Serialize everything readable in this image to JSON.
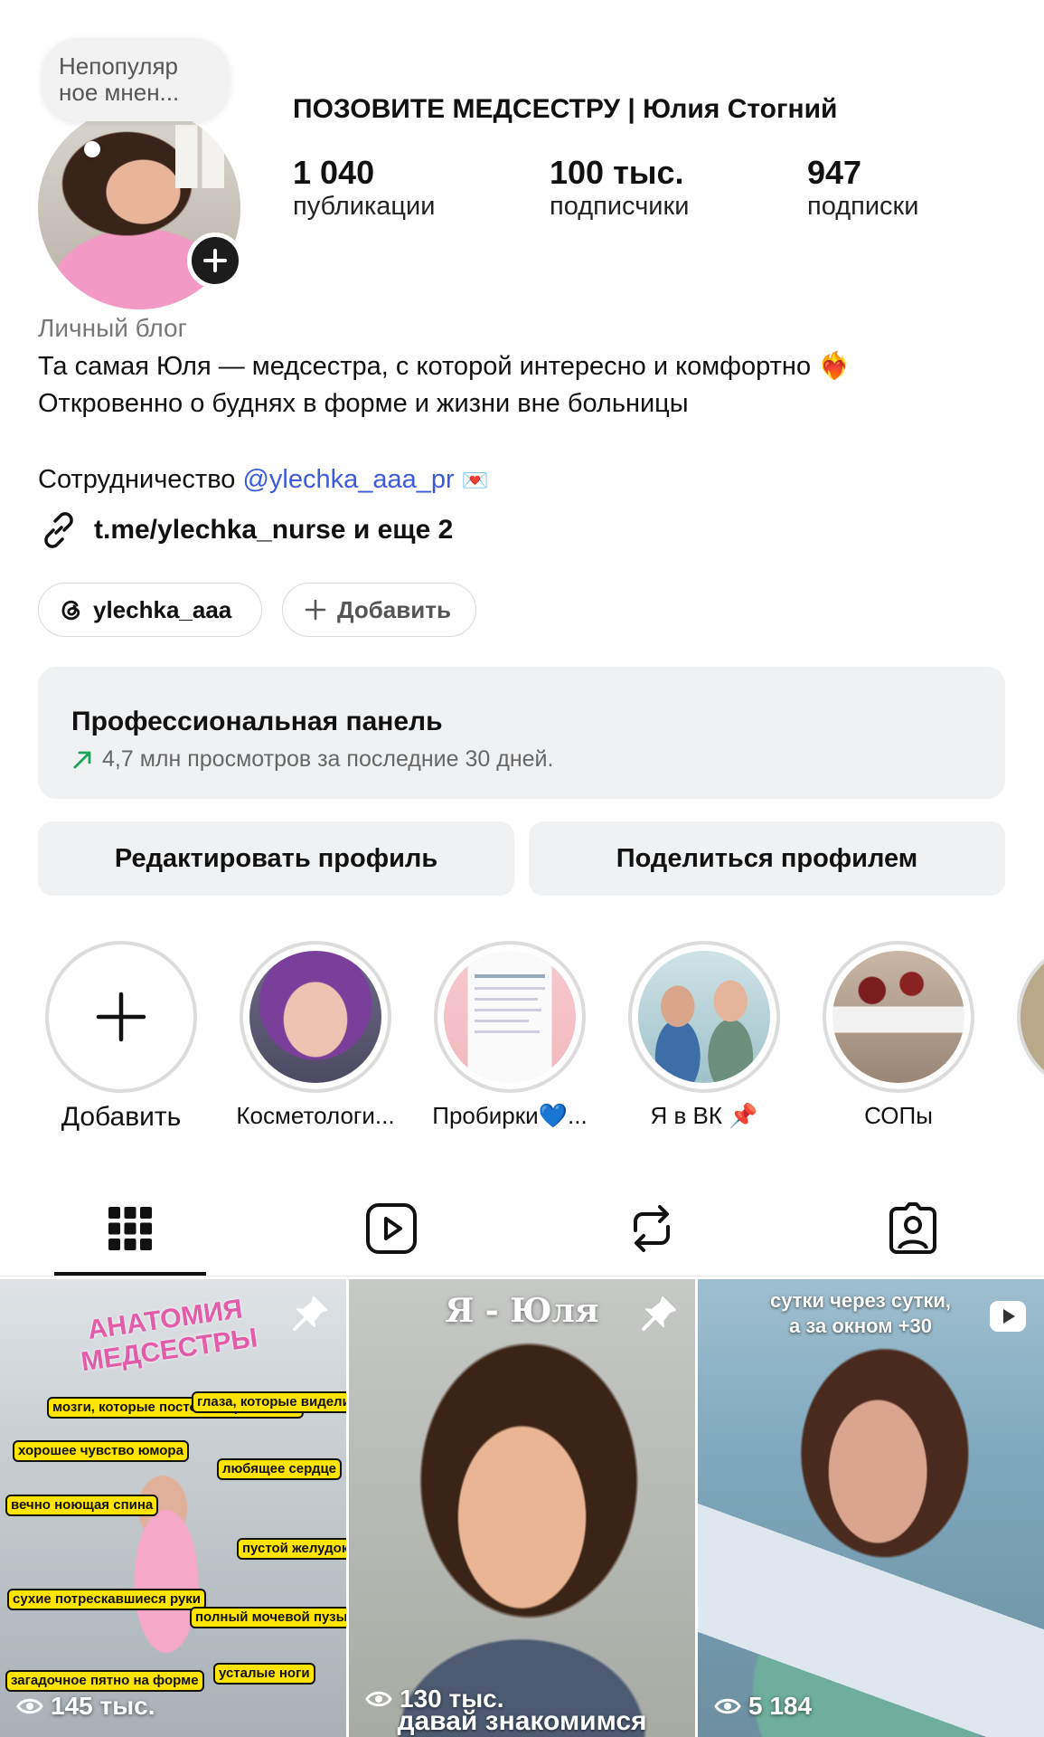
{
  "profile": {
    "note": "Непопуляр\nное мнен...",
    "name": "ПОЗОВИТЕ МЕДСЕСТРУ | Юлия Стогний",
    "stats": [
      {
        "value": "1 040",
        "label": "публикации"
      },
      {
        "value": "100 тыс.",
        "label": "подписчики"
      },
      {
        "value": "947",
        "label": "подписки"
      }
    ]
  },
  "bio": {
    "category": "Личный блог",
    "line1": "Та самая Юля — медсестра, с которой интересно и комфортно",
    "line2": "Откровенно о буднях в форме и жизни вне больницы",
    "collab_prefix": "Сотрудничество ",
    "collab_mention": "@ylechka_aaa_pr",
    "link": "t.me/ylechka_nurse и еще 2"
  },
  "chips": {
    "threads": "ylechka_aaa",
    "add": "Добавить"
  },
  "pro_panel": {
    "title": "Профессиональная панель",
    "subtitle": "4,7 млн просмотров за последние 30 дней."
  },
  "buttons": {
    "edit": "Редактировать профиль",
    "share": "Поделиться профилем"
  },
  "highlights": [
    {
      "label": "Добавить"
    },
    {
      "label": "Косметологи..."
    },
    {
      "label": "Пробирки💙..."
    },
    {
      "label": "Я в ВК 📌"
    },
    {
      "label": "СОПы"
    }
  ],
  "tabs": [
    {
      "icon": "grid-icon"
    },
    {
      "icon": "reels-icon"
    },
    {
      "icon": "reposts-icon"
    },
    {
      "icon": "tagged-icon"
    }
  ],
  "grid": [
    {
      "views": "145 тыс.",
      "pinned": true,
      "title": "АНАТОМИЯ МЕДСЕСТРЫ",
      "labels": [
        "мозги, которые постоянно работают",
        "глаза, которые видели всё",
        "хорошее чувство юмора",
        "любящее сердце",
        "вечно ноющая спина",
        "пустой желудок",
        "сухие потрескавшиеся руки",
        "полный мочевой пузырь",
        "загадочное пятно на форме",
        "усталые ноги"
      ]
    },
    {
      "views": "130 тыс.",
      "pinned": true,
      "title": "Я - Юля",
      "caption": "давай знакомимся"
    },
    {
      "views": "5 184",
      "pinned": false,
      "caption": "сутки через сутки,\nа за окном +30"
    }
  ],
  "colors": {
    "link": "#3b5bdb",
    "panel_bg": "#eff1f3",
    "trend_arrow": "#1aa35a"
  }
}
